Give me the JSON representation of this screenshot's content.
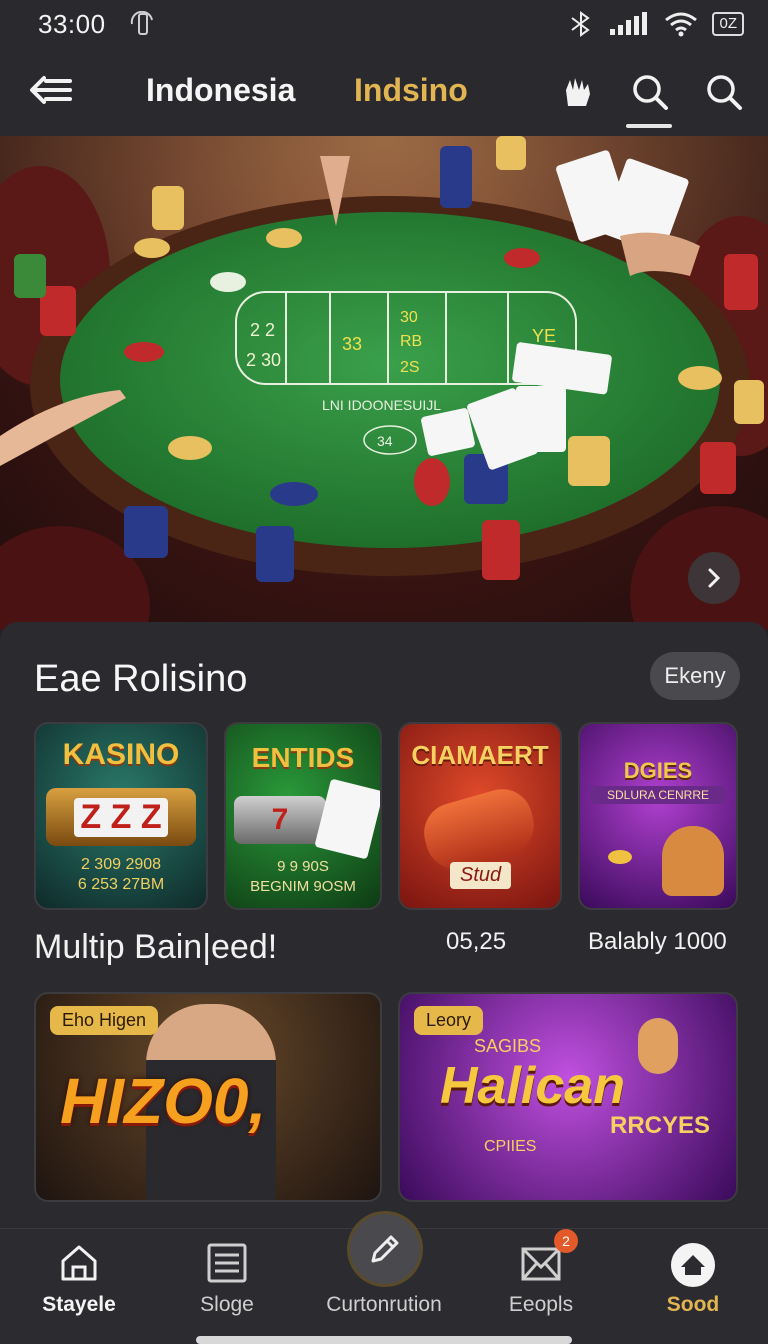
{
  "status": {
    "time": "33:00",
    "battery": "0Z"
  },
  "header": {
    "title_primary": "Indonesia",
    "title_secondary": "Indsino"
  },
  "hero": {
    "table_text": "LNI IDOONESUIJL",
    "table_number": "34",
    "table_cells": [
      "2 2",
      "2 30",
      "33",
      "30",
      "RB",
      "2S",
      "YE"
    ]
  },
  "section": {
    "title": "Eae Rolisino",
    "pill": "Ekeny"
  },
  "tiles": [
    {
      "title": "KASINO",
      "line1": "2 309 2908",
      "line2": "6 253 27BM",
      "reel": "Z Z Z"
    },
    {
      "title": "ENTIDS",
      "line1": "9 9 90S",
      "line2": "BEGNIM 9OSM",
      "reel": "7"
    },
    {
      "title": "CIAMAERT",
      "sub": "Stud"
    },
    {
      "title": "DGIES",
      "sub": "SDLURA CENRRE"
    }
  ],
  "meta": {
    "left": "Multip Bain|eed!",
    "middle": "05,25",
    "right": "Balably 1000"
  },
  "banners": [
    {
      "tag": "Eho Higen",
      "title": "HIZO0,"
    },
    {
      "tag": "Leory",
      "title": "Halican",
      "sub1": "SAGIBS",
      "sub2": "RRCYES",
      "sub3": "CPIIES"
    }
  ],
  "nav": {
    "items": [
      {
        "label": "Stayele",
        "icon": "home-icon"
      },
      {
        "label": "Sloge",
        "icon": "list-icon"
      },
      {
        "label": "Curtonrution",
        "icon": "pencil-icon"
      },
      {
        "label": "Eeopls",
        "icon": "mail-icon",
        "badge": "2"
      },
      {
        "label": "Sood",
        "icon": "star-home-icon"
      }
    ]
  },
  "colors": {
    "accent": "#e2b552",
    "felt": "#2d8a3a",
    "bg": "#222226"
  }
}
